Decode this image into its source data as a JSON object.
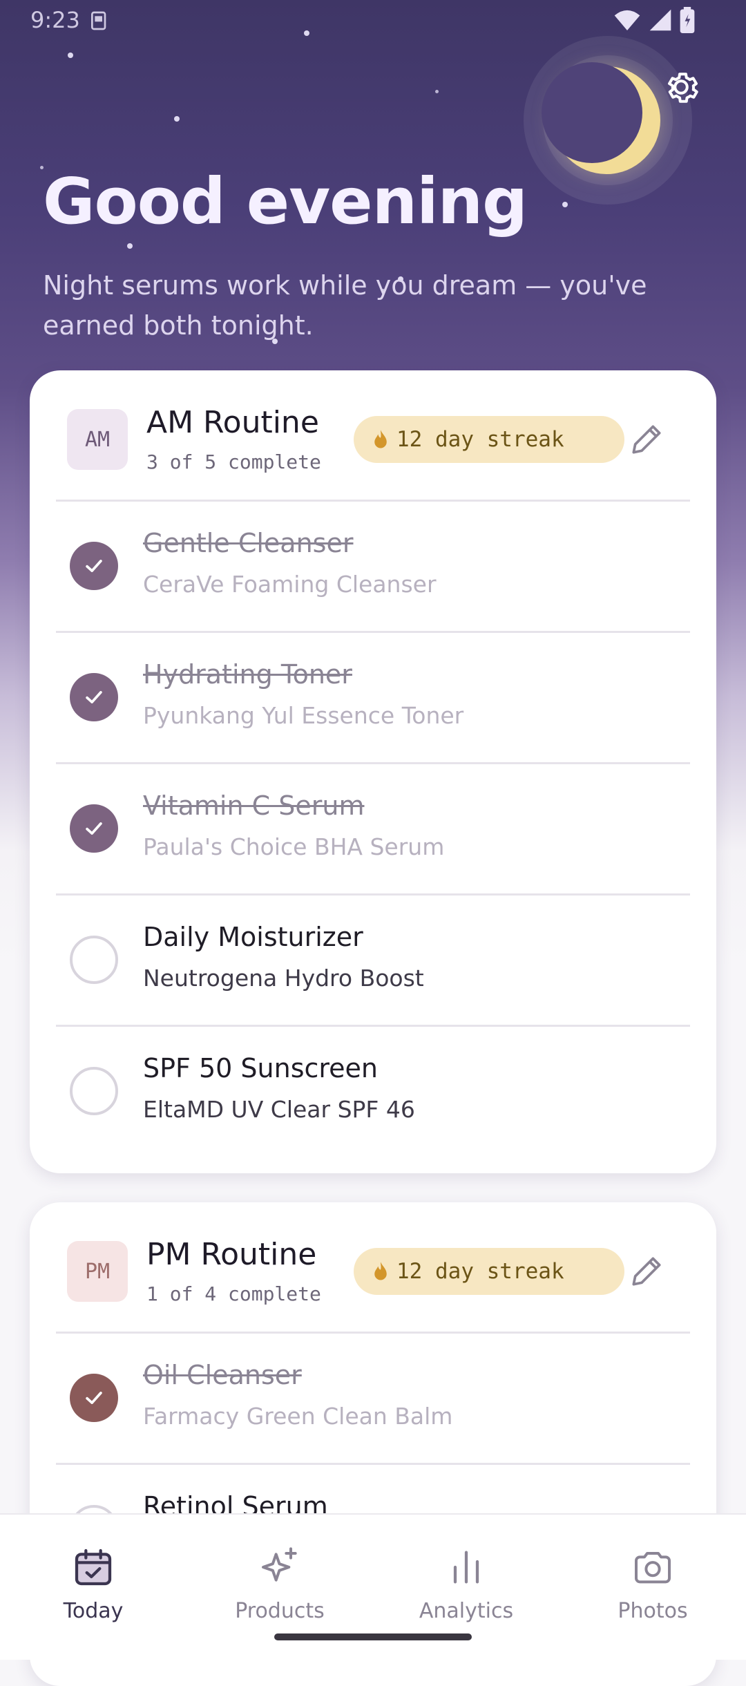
{
  "status_bar": {
    "time": "9:23"
  },
  "header": {
    "greeting": "Good evening",
    "subtitle": "Night serums work while you dream — you've earned both tonight."
  },
  "am_routine": {
    "badge": "AM",
    "title": "AM Routine",
    "progress": "3 of 5 complete",
    "streak": "12 day streak",
    "items": [
      {
        "name": "Gentle Cleanser",
        "product": "CeraVe Foaming Cleanser",
        "done": true
      },
      {
        "name": "Hydrating Toner",
        "product": "Pyunkang Yul Essence Toner",
        "done": true
      },
      {
        "name": "Vitamin C Serum",
        "product": "Paula's Choice BHA Serum",
        "done": true
      },
      {
        "name": "Daily Moisturizer",
        "product": "Neutrogena Hydro Boost",
        "done": false
      },
      {
        "name": "SPF 50 Sunscreen",
        "product": "EltaMD UV Clear SPF 46",
        "done": false
      }
    ]
  },
  "pm_routine": {
    "badge": "PM",
    "title": "PM Routine",
    "progress": "1 of 4 complete",
    "streak": "12 day streak",
    "items": [
      {
        "name": "Oil Cleanser",
        "product": "Farmacy Green Clean Balm",
        "done": true
      },
      {
        "name": "Retinol Serum",
        "product": "",
        "done": false
      }
    ]
  },
  "nav": {
    "items": [
      {
        "label": "Today",
        "icon": "calendar-check-icon",
        "active": true
      },
      {
        "label": "Products",
        "icon": "sparkle-icon",
        "active": false
      },
      {
        "label": "Analytics",
        "icon": "bar-chart-icon",
        "active": false
      },
      {
        "label": "Photos",
        "icon": "camera-icon",
        "active": false
      }
    ]
  },
  "colors": {
    "accent": "#7c6380",
    "streak_bg": "#f7e7c2",
    "moon": "#f2dc97"
  }
}
